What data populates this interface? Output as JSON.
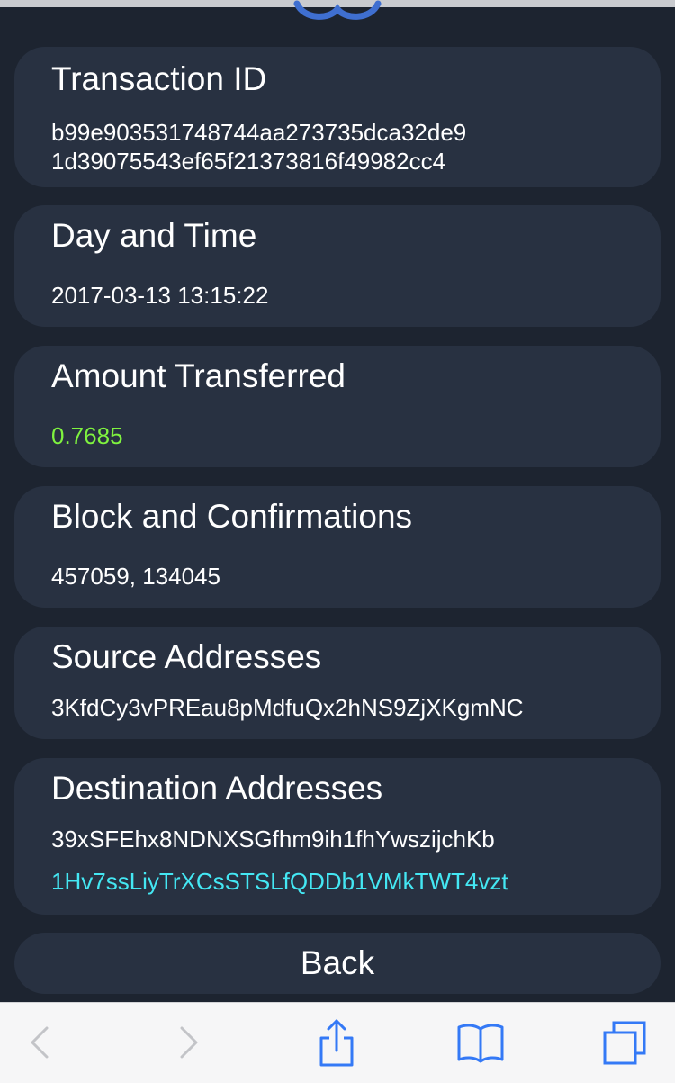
{
  "transaction": {
    "id_title": "Transaction ID",
    "id_line1": "b99e903531748744aa273735dca32de9",
    "id_line2": "1d39075543ef65f21373816f49982cc4"
  },
  "datetime": {
    "title": "Day and Time",
    "value": "2017-03-13 13:15:22"
  },
  "amount": {
    "title": "Amount Transferred",
    "value": "0.7685",
    "color": "#7ff33f"
  },
  "block": {
    "title": "Block and Confirmations",
    "value": "457059, 134045"
  },
  "source": {
    "title": "Source Addresses",
    "addresses": [
      "3KfdCy3vPREau8pMdfuQx2hNS9ZjXKgmNC"
    ]
  },
  "destination": {
    "title": "Destination Addresses",
    "addresses": [
      "39xSFEhx8NDNXSGfhm9ih1fhYwszijchKb",
      "1Hv7ssLiyTrXCsSTSLfQDDb1VMkTWT4vzt"
    ],
    "highlight_color": "#44e7f3"
  },
  "actions": {
    "back_label": "Back"
  },
  "browser_toolbar": {
    "icons": [
      "back-arrow-icon",
      "forward-arrow-icon",
      "share-icon",
      "bookmarks-icon",
      "tabs-icon"
    ]
  },
  "colors": {
    "background": "#1d2430",
    "card": "#283141",
    "accent": "#3f6fd0"
  }
}
